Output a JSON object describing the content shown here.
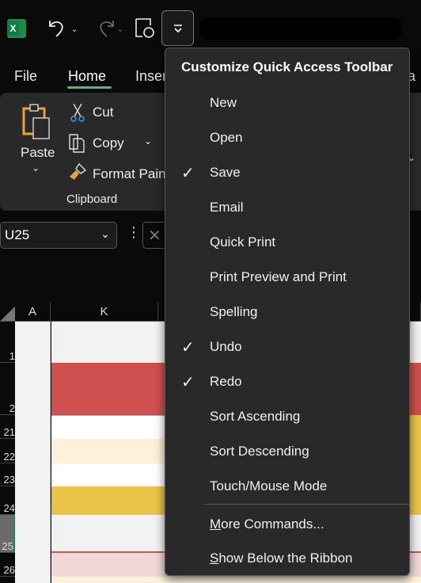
{
  "qat": {
    "app_icon": "excel-icon",
    "undo_icon": "undo-icon",
    "redo_icon": "redo-icon",
    "autosave_icon": "save-sync-icon",
    "customize_icon": "customize-dropdown-icon"
  },
  "tabs": [
    {
      "label": "File"
    },
    {
      "label": "Home",
      "active": true
    },
    {
      "label": "Inser"
    },
    {
      "label": "ata"
    }
  ],
  "accent": "#4fbd7a",
  "clipboard": {
    "paste": "Paste",
    "cut": "Cut",
    "copy": "Copy",
    "format_painter": "Format Pain",
    "group": "Clipboard"
  },
  "namebox": {
    "value": "U25"
  },
  "columns": [
    "A",
    "K"
  ],
  "rows": [
    "1",
    "2",
    "21",
    "22",
    "23",
    "24",
    "25",
    "26"
  ],
  "menu": {
    "title": "Customize Quick Access Toolbar",
    "items": [
      {
        "label": "New",
        "checked": false
      },
      {
        "label": "Open",
        "checked": false
      },
      {
        "label": "Save",
        "checked": true
      },
      {
        "label": "Email",
        "checked": false
      },
      {
        "label": "Quick Print",
        "checked": false
      },
      {
        "label": "Print Preview and Print",
        "checked": false
      },
      {
        "label": "Spelling",
        "checked": false
      },
      {
        "label": "Undo",
        "checked": true
      },
      {
        "label": "Redo",
        "checked": true
      },
      {
        "label": "Sort Ascending",
        "checked": false
      },
      {
        "label": "Sort Descending",
        "checked": false
      },
      {
        "label": "Touch/Mouse Mode",
        "checked": false
      }
    ],
    "more_commands": {
      "key": "M",
      "rest": "ore Commands..."
    },
    "show_below": {
      "key": "S",
      "rest": "how Below the Ribbon"
    }
  },
  "check_glyph": "✓"
}
